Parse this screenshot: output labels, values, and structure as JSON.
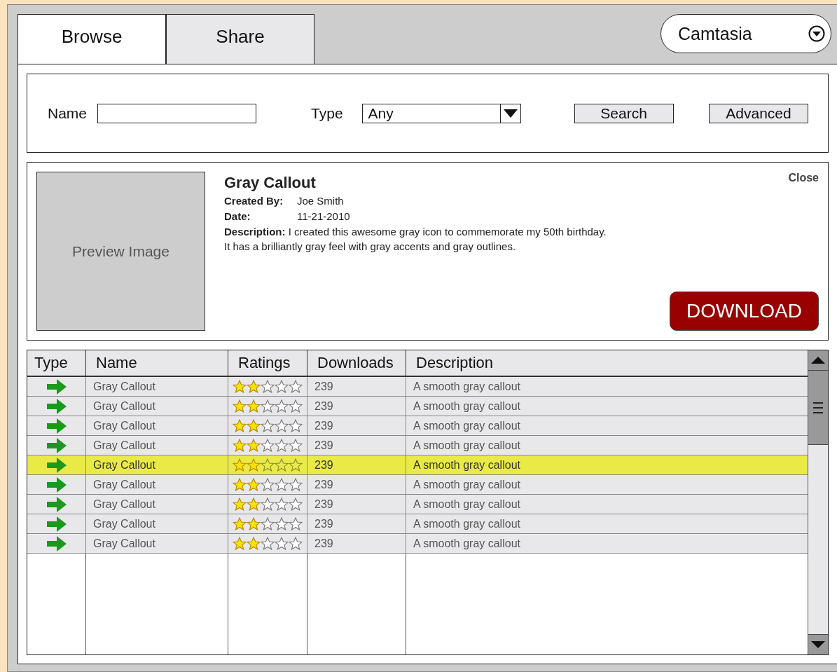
{
  "tabs": [
    {
      "label": "Browse",
      "selected": true
    },
    {
      "label": "Share",
      "selected": false
    }
  ],
  "app_selector": {
    "value": "Camtasia"
  },
  "search": {
    "name_label": "Name",
    "type_label": "Type",
    "type_value": "Any",
    "buttons": [
      "Search",
      "Advanced"
    ]
  },
  "detail": {
    "preview": "Preview Image",
    "title": "Gray Callout",
    "close": "Close",
    "fields": [
      {
        "label": "Created By:",
        "value": "Joe Smith"
      },
      {
        "label": "Date:",
        "value": "11-21-2010"
      }
    ],
    "description": "**Description:**  I created this awesome gray icon to commemorate my 50th birthday.",
    "description_more": "It has a brilliantly gray feel with gray accents and gray outlines.",
    "download": "DOWNLOAD"
  },
  "table": {
    "columns": [
      "Type",
      "Name",
      "Ratings",
      "Downloads",
      "Description"
    ],
    "rows": [
      {
        "name": "Gray Callout",
        "stars": 2,
        "downloads": "239",
        "description": "A smooth gray callout",
        "selected": false
      },
      {
        "name": "Gray Callout",
        "stars": 2,
        "downloads": "239",
        "description": "A smooth gray callout",
        "selected": false
      },
      {
        "name": "Gray Callout",
        "stars": 2,
        "downloads": "239",
        "description": "A smooth gray callout",
        "selected": false
      },
      {
        "name": "Gray Callout",
        "stars": 2,
        "downloads": "239",
        "description": "A smooth gray callout",
        "selected": false
      },
      {
        "name": "Gray Callout",
        "stars": 2,
        "downloads": "239",
        "description": "A smooth gray callout",
        "selected": true
      },
      {
        "name": "Gray Callout",
        "stars": 2,
        "downloads": "239",
        "description": "A smooth gray callout",
        "selected": false
      },
      {
        "name": "Gray Callout",
        "stars": 2,
        "downloads": "239",
        "description": "A smooth gray callout",
        "selected": false
      },
      {
        "name": "Gray Callout",
        "stars": 2,
        "downloads": "239",
        "description": "A smooth gray callout",
        "selected": false
      },
      {
        "name": "Gray Callout",
        "stars": 2,
        "downloads": "239",
        "description": "A smooth gray callout",
        "selected": false
      }
    ]
  }
}
